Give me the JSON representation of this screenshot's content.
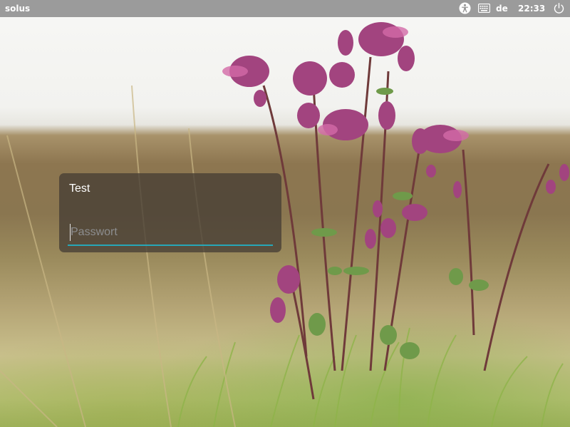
{
  "topbar": {
    "brand": "solus",
    "keyboard_layout": "de",
    "clock": "22:33",
    "icons": {
      "accessibility": "accessibility-icon",
      "keyboard": "keyboard-icon",
      "power": "power-icon"
    }
  },
  "login": {
    "username": "Test",
    "password_placeholder": "Passwort",
    "password_value": ""
  },
  "colors": {
    "topbar_bg": "#9b9b9b",
    "accent": "#27a7b8",
    "card_bg": "rgba(70,62,52,0.78)"
  }
}
